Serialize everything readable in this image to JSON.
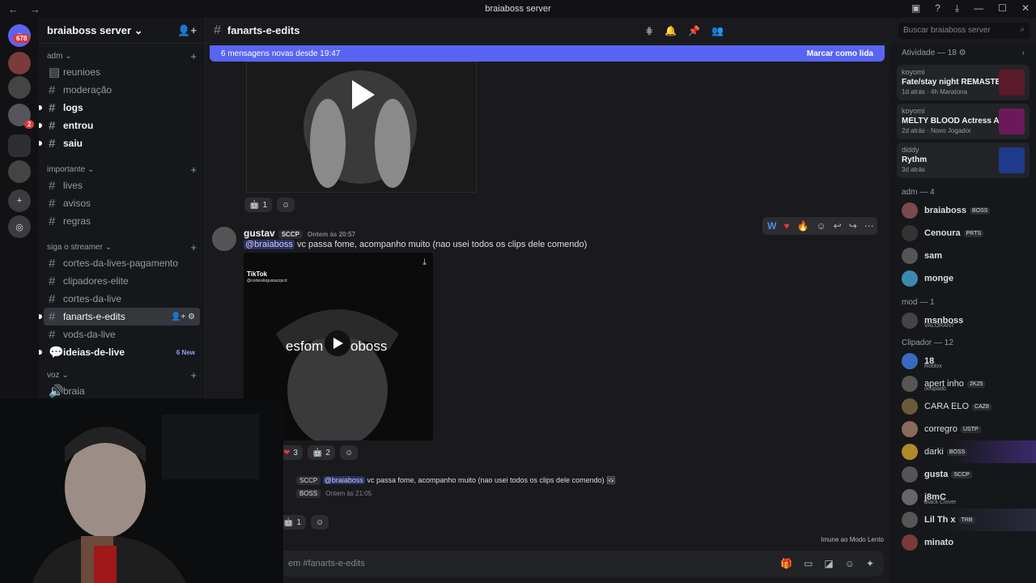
{
  "window": {
    "title": "braiaboss server",
    "back": "←",
    "forward": "→"
  },
  "guild_badges": {
    "home_count": "678",
    "dm_count": "2"
  },
  "server": {
    "name": "braiaboss server"
  },
  "categories": [
    {
      "name": "adm",
      "channels": [
        {
          "name": "reunioes"
        },
        {
          "name": "moderação"
        },
        {
          "name": "logs"
        },
        {
          "name": "entrou"
        },
        {
          "name": "saiu"
        }
      ]
    },
    {
      "name": "importante",
      "channels": [
        {
          "name": "lives"
        },
        {
          "name": "avisos"
        },
        {
          "name": "regras"
        }
      ]
    },
    {
      "name": "siga o streamer",
      "channels": [
        {
          "name": "cortes-da-lives-pagamento"
        },
        {
          "name": "clipadores-elite"
        },
        {
          "name": "cortes-da-live"
        },
        {
          "name": "fanarts-e-edits"
        },
        {
          "name": "vods-da-live"
        },
        {
          "name": "ideias-de-live",
          "badge": "6 New"
        }
      ]
    },
    {
      "name": "voz",
      "channels": [
        {
          "name": "braia"
        }
      ]
    }
  ],
  "channel": {
    "name": "fanarts-e-edits"
  },
  "search": {
    "placeholder": "Buscar braiaboss server"
  },
  "banner": {
    "text": "6 mensagens novas desde 19:47",
    "action": "Marcar como lida"
  },
  "messages": [
    {
      "author": "gustav",
      "tag": "SCCP",
      "time": "Ontem às 20:57",
      "mention": "@braiaboss",
      "text": "vc passa fome, acompanho muito (nao usei todos os clips dele comendo)",
      "embed": {
        "provider": "TikTok",
        "handle": "@cortesdogustazzpcd",
        "caption_left": "esfom",
        "caption_right": "oboss"
      },
      "reactions": [
        {
          "emoji": "❤",
          "count": "3"
        },
        {
          "emoji": "🤖",
          "count": "2"
        }
      ]
    },
    {
      "reply_tag": "SCCP",
      "mention": "@braiaboss",
      "text": "vc passa fome, acompanho muito (nao usei todos os clips dele comendo)",
      "tag2": "BOSS",
      "time": "Ontem às 21:05",
      "reactions": [
        {
          "emoji": "🤖",
          "count": "1"
        }
      ]
    }
  ],
  "first_reactions": [
    {
      "emoji": "🤖",
      "count": "1"
    }
  ],
  "composer": {
    "placeholder": "em #fanarts-e-edits"
  },
  "slowmode": "Imune ao Modo Lento",
  "activity": {
    "title": "Atividade — 18",
    "cards": [
      {
        "user": "koyomi",
        "game": "Fate/stay night REMASTE...",
        "meta": "1d atrás · 4h Maratona",
        "color": "#5a1a2a"
      },
      {
        "user": "koyomi",
        "game": "MELTY BLOOD Actress Ag...",
        "meta": "2d atrás · Novo Jogador",
        "color": "#6a1a5a"
      },
      {
        "user": "diddy",
        "game": "Rythm",
        "meta": "3d atrás",
        "color": "#1e3a8a"
      }
    ]
  },
  "member_groups": [
    {
      "name": "adm — 4",
      "members": [
        {
          "name": "braiaboss",
          "tag": "BOSS"
        },
        {
          "name": "Cenoura",
          "tag": "PRTS"
        },
        {
          "name": "sam"
        },
        {
          "name": "monge"
        }
      ]
    },
    {
      "name": "mod — 1",
      "members": [
        {
          "name": "msnboss",
          "sub": "VALORANT"
        }
      ]
    },
    {
      "name": "Clipador — 12",
      "members": [
        {
          "name": "18",
          "sub": "Roblox"
        },
        {
          "name": "apert inho",
          "tag": "2K25",
          "sub": "ocupado"
        },
        {
          "name": "CARA ELO",
          "tag": "CAZ8"
        },
        {
          "name": "corregro",
          "tag": "USTP"
        },
        {
          "name": "darki",
          "tag": "BOSS"
        },
        {
          "name": "gusta",
          "tag": "SCCP"
        },
        {
          "name": "j8mC",
          "sub": "Black Clover"
        },
        {
          "name": "Lil Th x",
          "tag": "TRB"
        },
        {
          "name": "minato"
        }
      ]
    }
  ]
}
